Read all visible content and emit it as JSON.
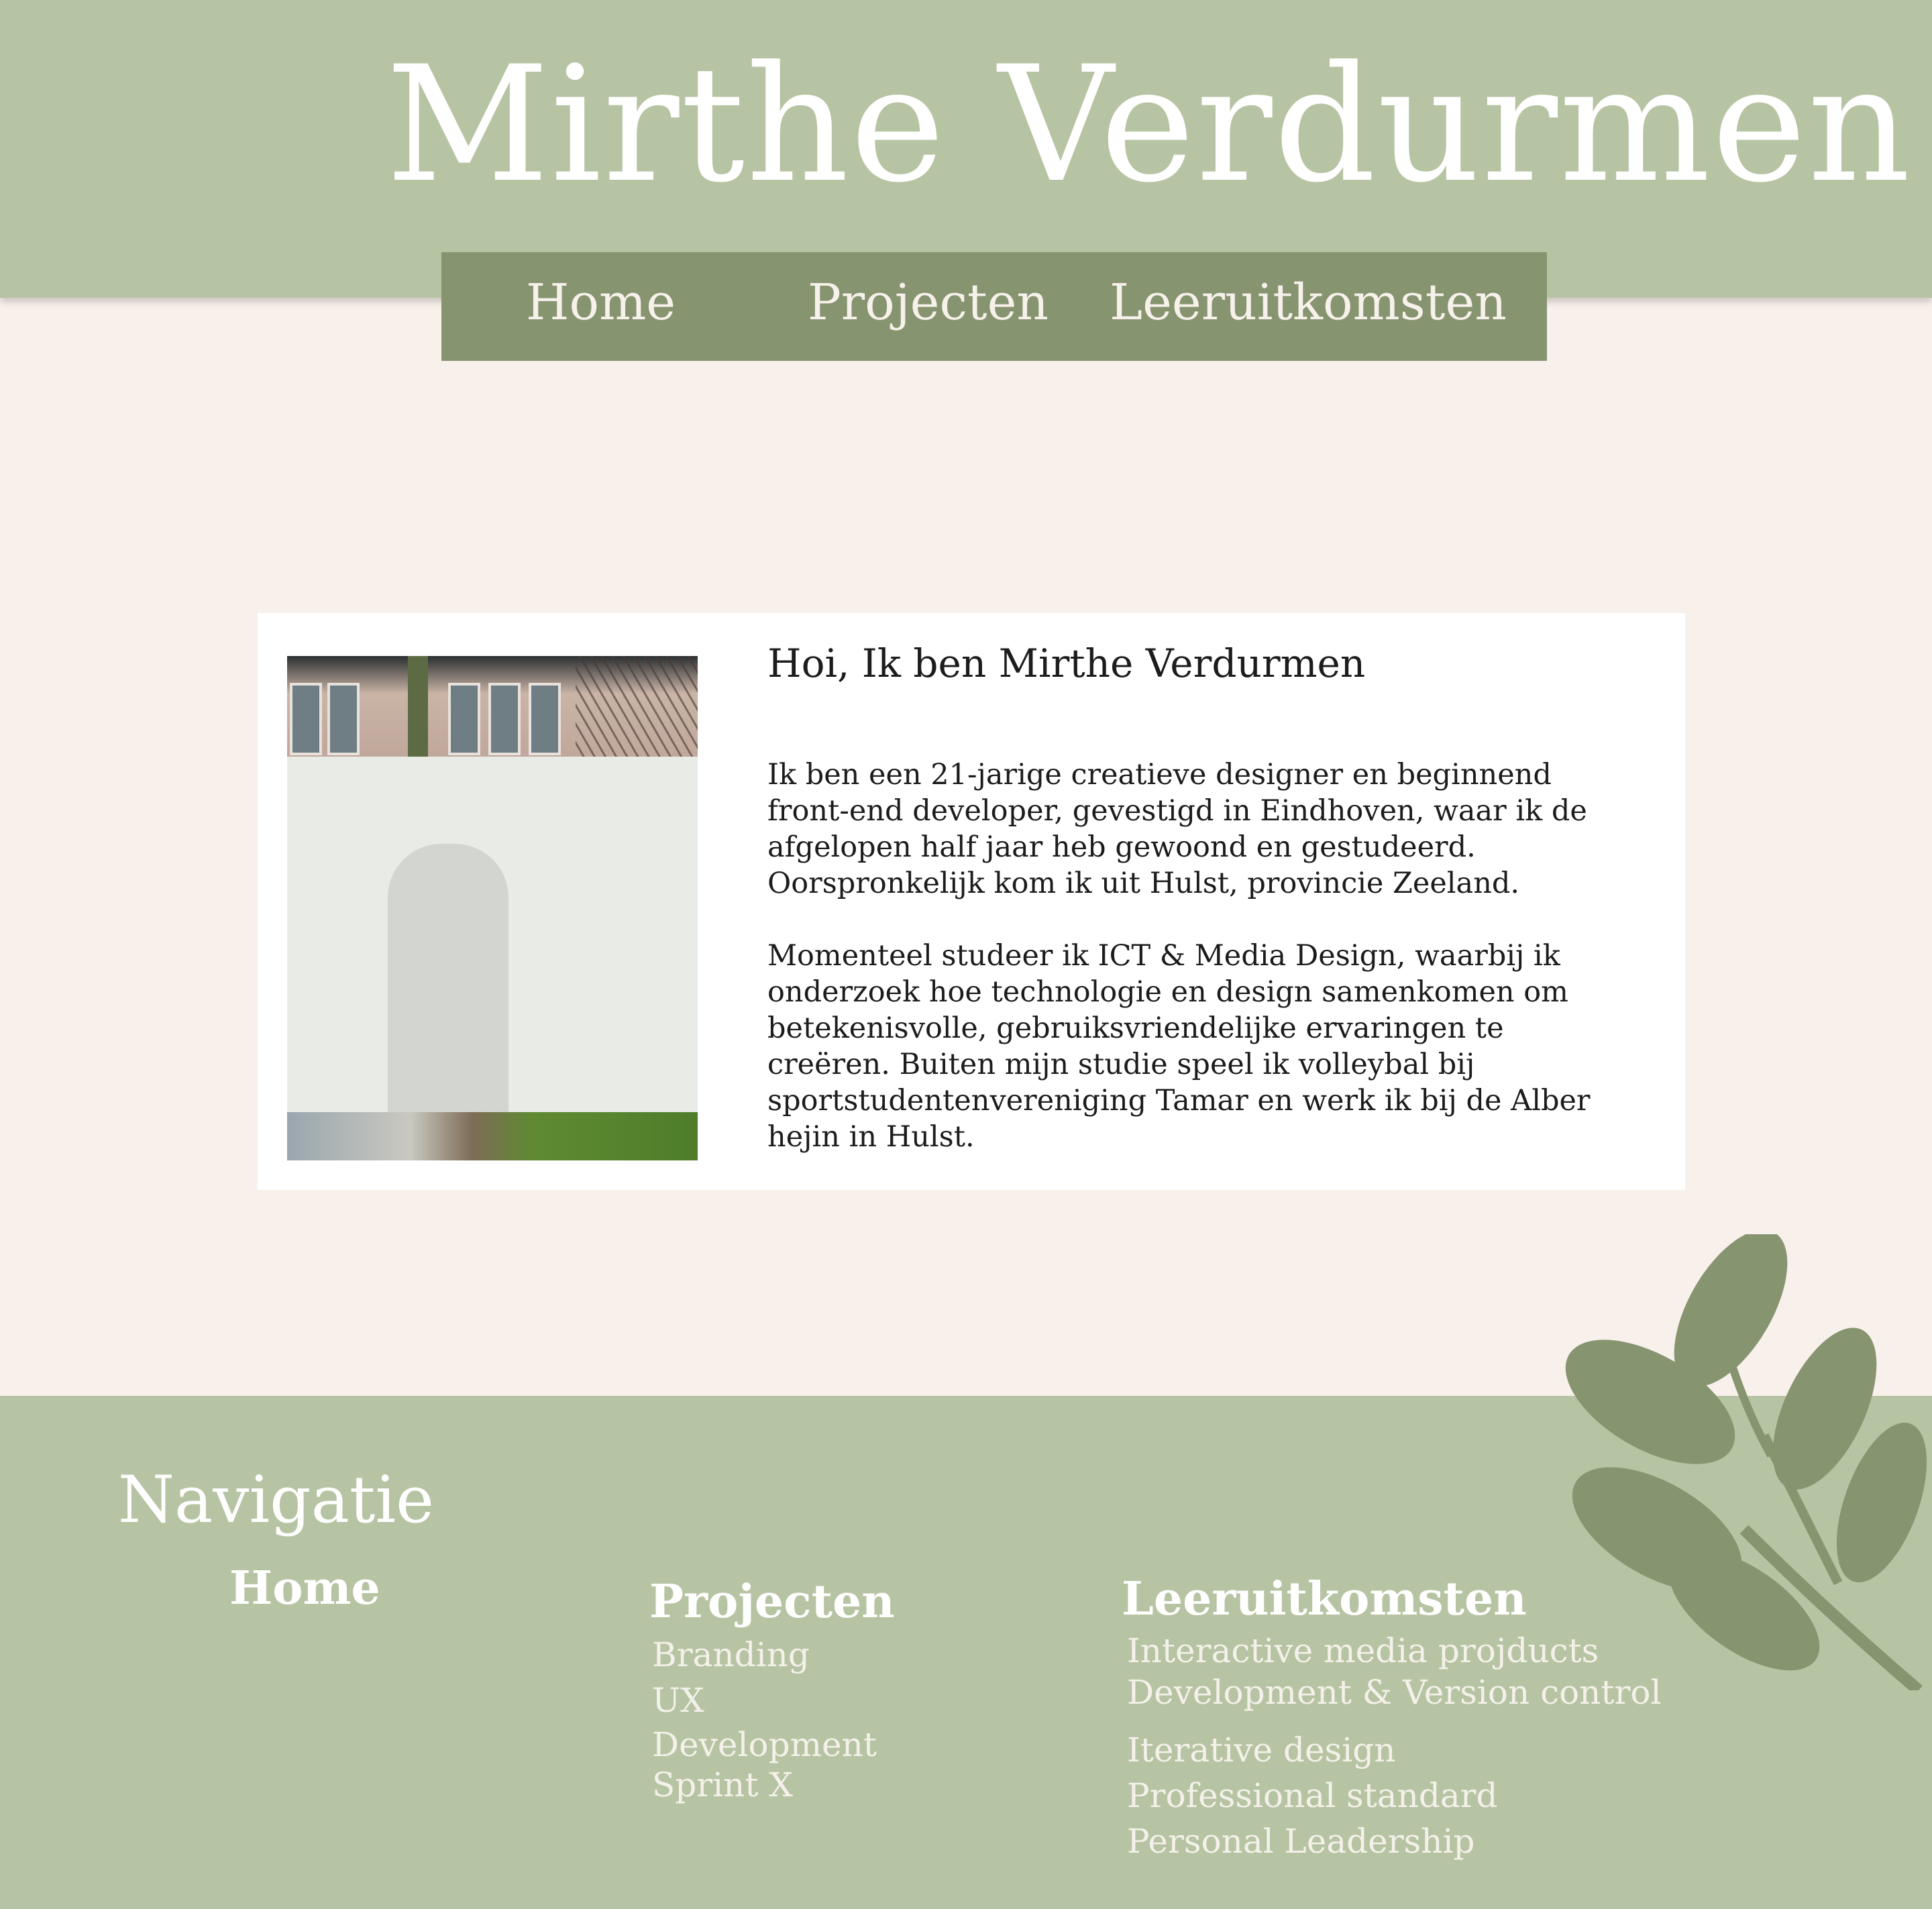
{
  "header": {
    "title": "Mirthe  Verdurmen",
    "nav": [
      {
        "label": "Home"
      },
      {
        "label": "Projecten"
      },
      {
        "label": "Leeruitkomsten"
      }
    ]
  },
  "intro": {
    "title": "Hoi, Ik ben Mirthe Verdurmen",
    "paragraph_1": "Ik ben een 21-jarige creatieve designer en beginnend front-end developer, gevestigd in Eindhoven, waar ik de afgelopen half jaar heb gewoond en gestudeerd. Oorspronkelijk kom ik uit Hulst, provincie Zeeland.",
    "paragraph_2": "Momenteel studeer ik ICT & Media Design, waarbij ik onderzoek hoe technologie en design samenkomen om betekenisvolle, gebruiksvriendelijke ervaringen te creëren. Buiten mijn studie speel ik volleybal bij sportstudentenvereniging Tamar en werk ik bij de Alber hejin in Hulst."
  },
  "footer": {
    "heading": "Navigatie",
    "columns": [
      {
        "title": "Home",
        "links": []
      },
      {
        "title": "Projecten",
        "links": [
          "Branding",
          "UX",
          "Development",
          "Sprint X"
        ]
      },
      {
        "title": "Leeruitkomsten",
        "links": [
          "Interactive media projducts",
          "Development & Version control",
          "Iterative design",
          "Professional standard",
          "Personal Leadership"
        ]
      }
    ]
  },
  "colors": {
    "header_green": "#b7c4a3",
    "nav_green": "#879470",
    "page_background": "#f8f0eb",
    "card_background": "#ffffff",
    "leaf_green": "#879470"
  },
  "icons": {
    "decoration": "leaf-branch-icon"
  }
}
